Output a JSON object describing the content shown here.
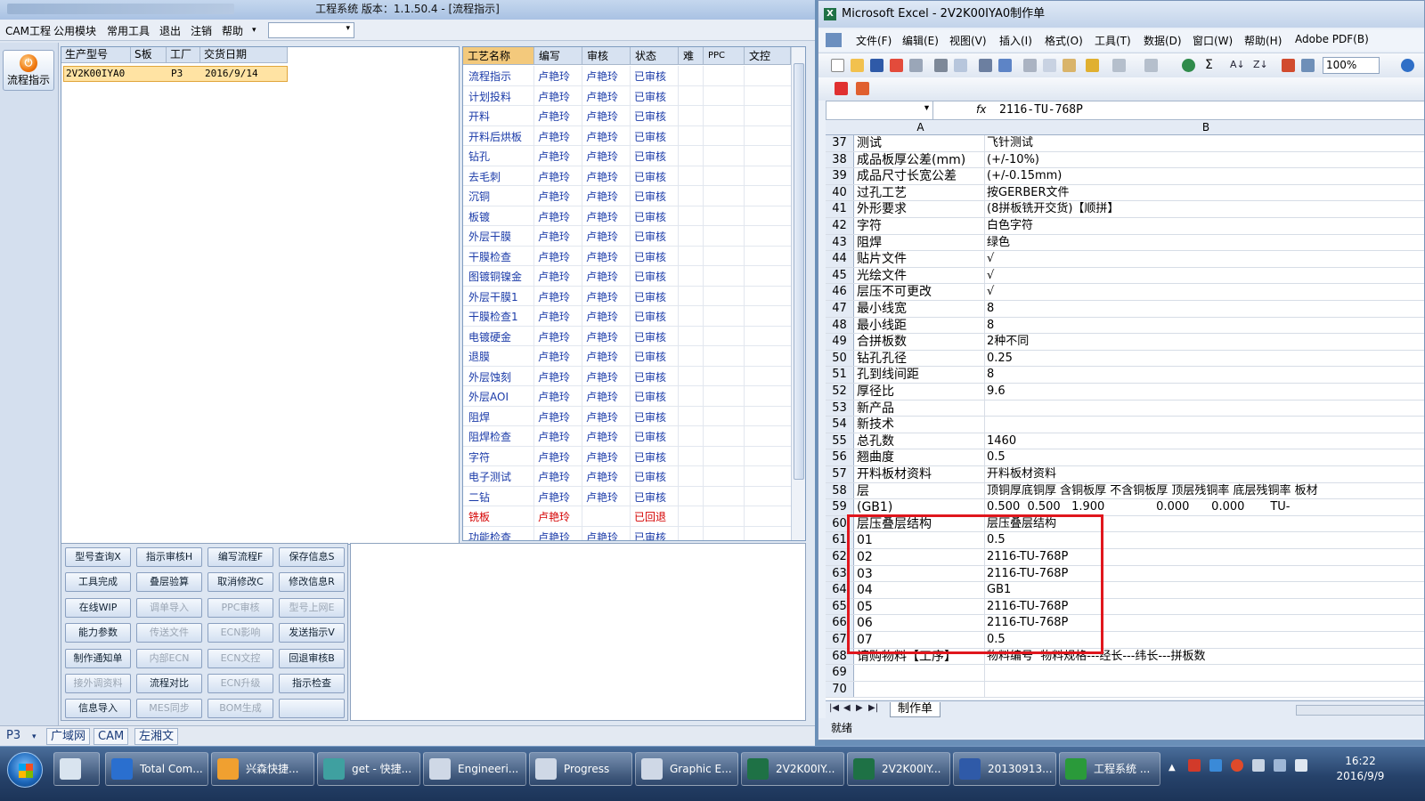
{
  "app": {
    "title": "工程系统  版本：1.1.50.4 - [流程指示]",
    "menu": [
      "CAM工程",
      "公用模块",
      "常用工具",
      "退出",
      "注销",
      "帮助"
    ],
    "menu_dropdown_arrow": "▾",
    "flow_button": "流程指示",
    "orders": {
      "headers": [
        "生产型号",
        "S板",
        "工厂",
        "交货日期"
      ],
      "rows": [
        {
          "model": "2V2K00IYA0",
          "sboard": "",
          "factory": "P3",
          "due": "2016/9/14"
        }
      ]
    },
    "processes": {
      "headers": [
        "工艺名称",
        "编写",
        "审核",
        "状态",
        "难",
        "PPC",
        "文控"
      ],
      "rows": [
        {
          "name": "流程指示",
          "writer": "卢艳玲",
          "reviewer": "卢艳玲",
          "status": "已审核"
        },
        {
          "name": "计划投料",
          "writer": "卢艳玲",
          "reviewer": "卢艳玲",
          "status": "已审核"
        },
        {
          "name": "开料",
          "writer": "卢艳玲",
          "reviewer": "卢艳玲",
          "status": "已审核"
        },
        {
          "name": "开料后烘板",
          "writer": "卢艳玲",
          "reviewer": "卢艳玲",
          "status": "已审核"
        },
        {
          "name": "钻孔",
          "writer": "卢艳玲",
          "reviewer": "卢艳玲",
          "status": "已审核"
        },
        {
          "name": "去毛刺",
          "writer": "卢艳玲",
          "reviewer": "卢艳玲",
          "status": "已审核"
        },
        {
          "name": "沉铜",
          "writer": "卢艳玲",
          "reviewer": "卢艳玲",
          "status": "已审核"
        },
        {
          "name": "板镀",
          "writer": "卢艳玲",
          "reviewer": "卢艳玲",
          "status": "已审核"
        },
        {
          "name": "外层干膜",
          "writer": "卢艳玲",
          "reviewer": "卢艳玲",
          "status": "已审核"
        },
        {
          "name": "干膜检查",
          "writer": "卢艳玲",
          "reviewer": "卢艳玲",
          "status": "已审核"
        },
        {
          "name": "图镀铜镍金",
          "writer": "卢艳玲",
          "reviewer": "卢艳玲",
          "status": "已审核"
        },
        {
          "name": "外层干膜1",
          "writer": "卢艳玲",
          "reviewer": "卢艳玲",
          "status": "已审核"
        },
        {
          "name": "干膜检查1",
          "writer": "卢艳玲",
          "reviewer": "卢艳玲",
          "status": "已审核"
        },
        {
          "name": "电镀硬金",
          "writer": "卢艳玲",
          "reviewer": "卢艳玲",
          "status": "已审核"
        },
        {
          "name": "退膜",
          "writer": "卢艳玲",
          "reviewer": "卢艳玲",
          "status": "已审核"
        },
        {
          "name": "外层蚀刻",
          "writer": "卢艳玲",
          "reviewer": "卢艳玲",
          "status": "已审核"
        },
        {
          "name": "外层AOI",
          "writer": "卢艳玲",
          "reviewer": "卢艳玲",
          "status": "已审核"
        },
        {
          "name": "阻焊",
          "writer": "卢艳玲",
          "reviewer": "卢艳玲",
          "status": "已审核"
        },
        {
          "name": "阻焊检查",
          "writer": "卢艳玲",
          "reviewer": "卢艳玲",
          "status": "已审核"
        },
        {
          "name": "字符",
          "writer": "卢艳玲",
          "reviewer": "卢艳玲",
          "status": "已审核"
        },
        {
          "name": "电子测试",
          "writer": "卢艳玲",
          "reviewer": "卢艳玲",
          "status": "已审核"
        },
        {
          "name": "二钻",
          "writer": "卢艳玲",
          "reviewer": "卢艳玲",
          "status": "已审核"
        },
        {
          "name": "铣板",
          "writer": "卢艳玲",
          "reviewer": "",
          "status": "已回退"
        },
        {
          "name": "功能检查",
          "writer": "卢艳玲",
          "reviewer": "卢艳玲",
          "status": "已审核"
        }
      ],
      "returned_color": "#d40000",
      "name_color": "#1a3aa8"
    },
    "buttons": [
      [
        "型号查询X",
        "指示审核H",
        "编写流程F",
        "保存信息S"
      ],
      [
        "工具完成",
        "叠层验算",
        "取消修改C",
        "修改信息R"
      ],
      [
        "在线WIP",
        "调单导入",
        "PPC审核",
        "型号上网E"
      ],
      [
        "能力参数",
        "传送文件",
        "ECN影响",
        "发送指示V"
      ],
      [
        "制作通知单",
        "内部ECN",
        "ECN文控",
        "回退审核B"
      ],
      [
        "接外调资料",
        "流程对比",
        "ECN升级",
        "指示检查"
      ],
      [
        "信息导入",
        "MES同步",
        "BOM生成",
        ""
      ]
    ],
    "status": {
      "plant": "P3",
      "dropdown_arrow": "▾",
      "tabs": [
        "广域网",
        "CAM",
        "左湘文"
      ]
    }
  },
  "excel": {
    "title": "Microsoft Excel - 2V2K00IYA0制作单",
    "menu": [
      "文件(F)",
      "编辑(E)",
      "视图(V)",
      "插入(I)",
      "格式(O)",
      "工具(T)",
      "数据(D)",
      "窗口(W)",
      "帮助(H)",
      "Adobe PDF(B)"
    ],
    "zoom": "100%",
    "sigma": "Σ",
    "sort_az": "A↓",
    "sort_za": "Z↓",
    "fx": "fx",
    "formula": "2116-TU-768P",
    "namebox_arrow": "▾",
    "columns": [
      "A",
      "B"
    ],
    "rows": [
      {
        "n": "37",
        "a": "测试",
        "b": "飞针测试"
      },
      {
        "n": "38",
        "a": "成品板厚公差(mm)",
        "b": "(+/-10%)"
      },
      {
        "n": "39",
        "a": "成品尺寸长宽公差",
        "b": "(+/-0.15mm)"
      },
      {
        "n": "40",
        "a": "过孔工艺",
        "b": "按GERBER文件"
      },
      {
        "n": "41",
        "a": "外形要求",
        "b": "(8拼板铣开交货)【顺拼】"
      },
      {
        "n": "42",
        "a": "字符",
        "b": "白色字符"
      },
      {
        "n": "43",
        "a": "阻焊",
        "b": "绿色"
      },
      {
        "n": "44",
        "a": "贴片文件",
        "b": "√"
      },
      {
        "n": "45",
        "a": "光绘文件",
        "b": "√"
      },
      {
        "n": "46",
        "a": "层压不可更改",
        "b": "√"
      },
      {
        "n": "47",
        "a": "最小线宽",
        "b": "8"
      },
      {
        "n": "48",
        "a": "最小线距",
        "b": "8"
      },
      {
        "n": "49",
        "a": "合拼板数",
        "b": "2种不同"
      },
      {
        "n": "50",
        "a": "钻孔孔径",
        "b": "0.25"
      },
      {
        "n": "51",
        "a": "孔到线间距",
        "b": "8"
      },
      {
        "n": "52",
        "a": "厚径比",
        "b": "9.6"
      },
      {
        "n": "53",
        "a": "新产品",
        "b": ""
      },
      {
        "n": "54",
        "a": "新技术",
        "b": ""
      },
      {
        "n": "55",
        "a": "总孔数",
        "b": "1460"
      },
      {
        "n": "56",
        "a": "翘曲度",
        "b": "0.5"
      },
      {
        "n": "57",
        "a": "开料板材资料",
        "b": "开料板材资料"
      },
      {
        "n": "58",
        "a": "层",
        "b": "顶铜厚底铜厚 含铜板厚 不含铜板厚 顶层残铜率 底层残铜率 板材"
      },
      {
        "n": "59",
        "a": "(GB1)",
        "b": "0.500  0.500   1.900              0.000      0.000       TU-"
      },
      {
        "n": "60",
        "a": "层压叠层结构",
        "b": "层压叠层结构"
      },
      {
        "n": "61",
        "a": "01",
        "b": "0.5"
      },
      {
        "n": "62",
        "a": "02",
        "b": "2116-TU-768P"
      },
      {
        "n": "63",
        "a": "03",
        "b": "2116-TU-768P"
      },
      {
        "n": "64",
        "a": "04",
        "b": "GB1"
      },
      {
        "n": "65",
        "a": "05",
        "b": "2116-TU-768P"
      },
      {
        "n": "66",
        "a": "06",
        "b": "2116-TU-768P"
      },
      {
        "n": "67",
        "a": "07",
        "b": "0.5"
      },
      {
        "n": "68",
        "a": "请购物料【工序】",
        "b": "物料编号  物料规格---经长---纬长---拼板数"
      },
      {
        "n": "69",
        "a": "",
        "b": ""
      },
      {
        "n": "70",
        "a": "",
        "b": ""
      }
    ],
    "sheet_nav": [
      "|◀",
      "◀",
      "▶",
      "▶|"
    ],
    "sheet_tab": "制作单",
    "status": "就绪",
    "highlight_color": "#e0161d"
  },
  "taskbar": {
    "items": [
      "",
      "Total Com...",
      "兴森快捷...",
      "get - 快捷...",
      "Engineeri...",
      "Progress",
      "Graphic E...",
      "2V2K00IY...",
      "2V2K00IY...",
      "20130913...",
      "工程系统 ..."
    ],
    "tray_arrow": "▲",
    "time": "16:22",
    "date": "2016/9/9"
  }
}
